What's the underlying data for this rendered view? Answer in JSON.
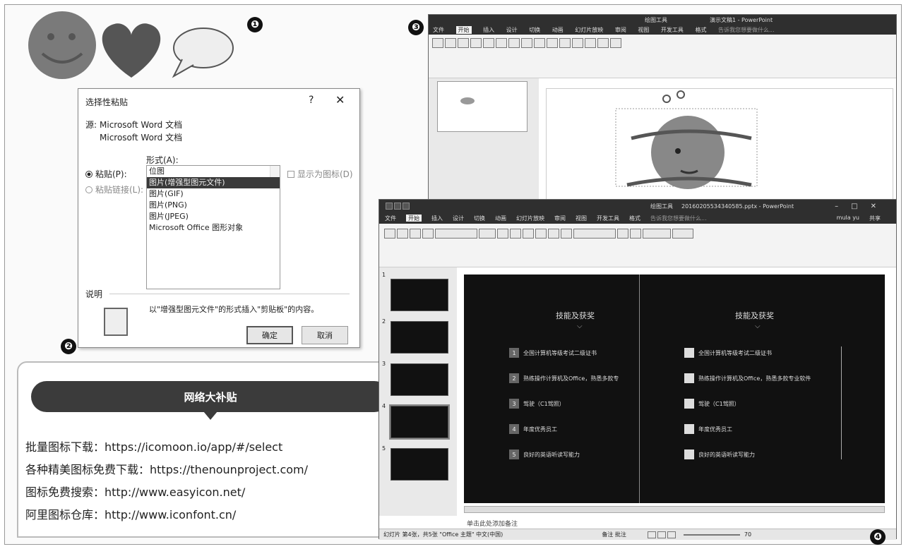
{
  "markers": [
    "❶",
    "❷",
    "❸",
    "❹"
  ],
  "dialog": {
    "title": "选择性粘贴",
    "help": "?",
    "close": "✕",
    "source_label": "源:",
    "source_line1": "Microsoft Word 文档",
    "source_line2": "Microsoft Word 文档",
    "format_label": "形式(A):",
    "paste_radio": "粘贴(P):",
    "paste_link_radio": "粘贴链接(L):",
    "show_as_icon": "显示为图标(D)",
    "formats": [
      "位图",
      "图片(增强型图元文件)",
      "图片(GIF)",
      "图片(PNG)",
      "图片(JPEG)",
      "Microsoft Office 图形对象"
    ],
    "selected_index": 1,
    "desc_label": "说明",
    "desc_text": "以\"增强型图元文件\"的形式插入\"剪贴板\"的内容。",
    "ok": "确定",
    "cancel": "取消"
  },
  "callout": {
    "title": "网络大补贴",
    "lines": [
      "批量图标下载：https://icomoon.io/app/#/select",
      "各种精美图标免费下载：https://thenounproject.com/",
      "图标免费搜索：http://www.easyicon.net/",
      "阿里图标仓库：http://www.iconfont.cn/"
    ]
  },
  "ppt1": {
    "title": "演示文稿1 - PowerPoint",
    "tool_tab": "绘图工具",
    "tabs": [
      "文件",
      "开始",
      "插入",
      "设计",
      "切换",
      "动画",
      "幻灯片放映",
      "审阅",
      "视图",
      "开发工具",
      "格式"
    ],
    "search": "告诉我您想要做什么..."
  },
  "ppt2": {
    "title": "20160205534340585.pptx - PowerPoint",
    "tool_tab": "绘图工具",
    "tabs": [
      "文件",
      "开始",
      "插入",
      "设计",
      "切换",
      "动画",
      "幻灯片放映",
      "审阅",
      "视图",
      "开发工具",
      "格式"
    ],
    "search": "告诉我您想要做什么...",
    "user": "mula yu",
    "share": "共享",
    "heading_left": "技能及获奖",
    "heading_right": "技能及获奖",
    "items_left": [
      {
        "n": "1",
        "text": "全国计算机等级考试二级证书"
      },
      {
        "n": "2",
        "text": "熟练操作计算机及Office，熟悉多款专"
      },
      {
        "n": "3",
        "text": "驾驶（C1驾照）"
      },
      {
        "n": "4",
        "text": "年度优秀员工"
      },
      {
        "n": "5",
        "text": "良好的英语听读写能力"
      }
    ],
    "items_right": [
      "全国计算机等级考试二级证书",
      "熟练操作计算机及Office，熟悉多款专业软件",
      "驾驶（C1驾照）",
      "年度优秀员工",
      "良好的英语听读写能力"
    ],
    "thumb_nums": [
      "1",
      "2",
      "3",
      "4",
      "5"
    ],
    "notes_hint": "单击此处添加备注",
    "status": "幻灯片 第4张，共5张  \"Office 主题\"  中文(中国)",
    "status_notes": "备注  批注",
    "zoom": "70"
  }
}
